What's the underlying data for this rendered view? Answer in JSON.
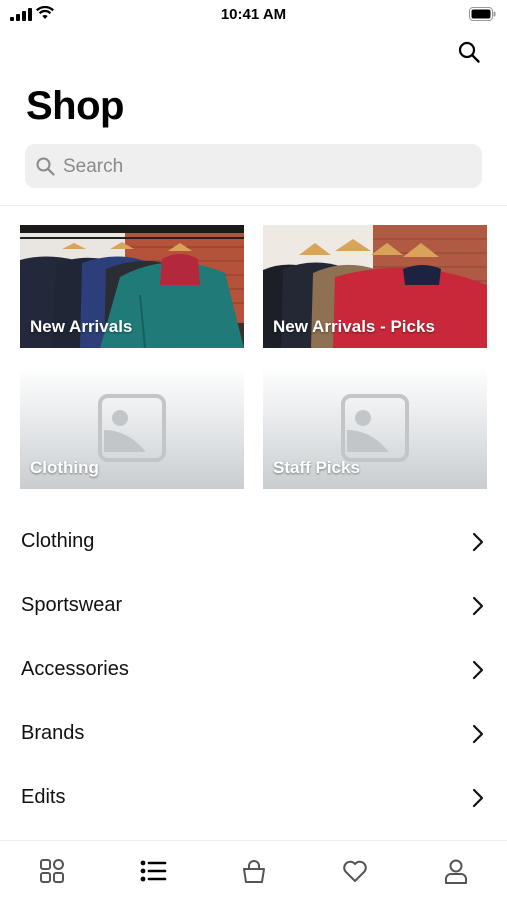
{
  "status_bar": {
    "time": "10:41 AM"
  },
  "header": {
    "title": "Shop"
  },
  "search": {
    "placeholder": "Search"
  },
  "tiles": [
    {
      "label": "New Arrivals"
    },
    {
      "label": "New Arrivals - Picks"
    },
    {
      "label": "Clothing"
    },
    {
      "label": "Staff Picks"
    }
  ],
  "categories": [
    {
      "label": "Clothing"
    },
    {
      "label": "Sportswear"
    },
    {
      "label": "Accessories"
    },
    {
      "label": "Brands"
    },
    {
      "label": "Edits"
    }
  ],
  "tabbar": {
    "items": [
      {
        "icon": "grid-icon"
      },
      {
        "icon": "list-icon",
        "active": true
      },
      {
        "icon": "bag-icon"
      },
      {
        "icon": "heart-icon"
      },
      {
        "icon": "profile-icon"
      }
    ]
  },
  "colors": {
    "accent": "#000000",
    "muted": "#8a8a8a",
    "search_bg": "#efefef",
    "icon_inactive": "#555555"
  }
}
